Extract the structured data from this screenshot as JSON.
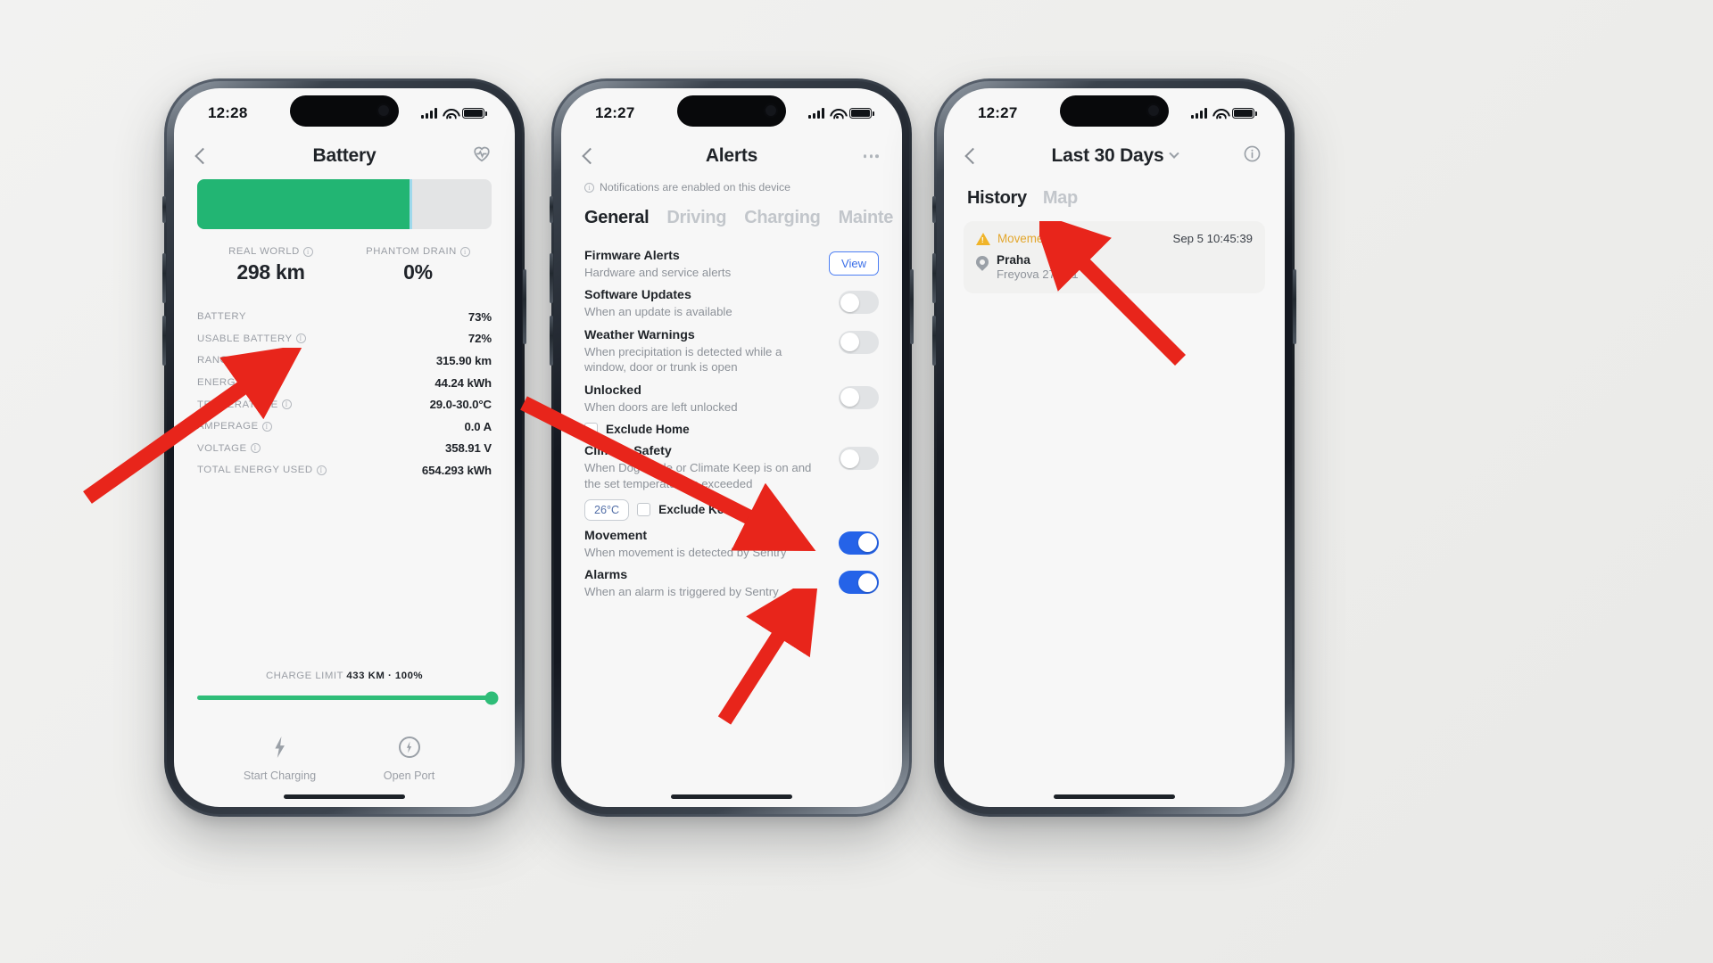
{
  "phones": [
    {
      "id": "battery",
      "status": {
        "time": "12:28",
        "signal_icon": "cellular-bars-icon",
        "wifi_icon": "wifi-icon",
        "battery_icon": "battery-icon"
      },
      "nav": {
        "back_icon": "chevron-left-icon",
        "title": "Battery",
        "right_icon": "vehicle-health-icon"
      },
      "battery_bar": {
        "charge_percent": 73,
        "usable_percent": 72,
        "fill_color": "#22b573",
        "track_color": "#e3e4e5"
      },
      "summary": [
        {
          "caption": "REAL WORLD",
          "info_icon": "info-icon",
          "value": "298 km"
        },
        {
          "caption": "PHANTOM DRAIN",
          "info_icon": "info-icon",
          "value": "0%"
        }
      ],
      "stats": [
        {
          "label": "BATTERY",
          "info": false,
          "value": "73%"
        },
        {
          "label": "USABLE BATTERY",
          "info": true,
          "value": "72%"
        },
        {
          "label": "RANGE",
          "info": true,
          "value": "315.90 km"
        },
        {
          "label": "ENERGY",
          "info": true,
          "value": "44.24 kWh"
        },
        {
          "label": "TEMPERATURE",
          "info": true,
          "value": "29.0-30.0°C"
        },
        {
          "label": "AMPERAGE",
          "info": true,
          "value": "0.0 A"
        },
        {
          "label": "VOLTAGE",
          "info": true,
          "value": "358.91 V"
        },
        {
          "label": "TOTAL ENERGY USED",
          "info": true,
          "value": "654.293 kWh"
        }
      ],
      "charge_limit": {
        "caption": "CHARGE LIMIT",
        "value": "433 KM · 100%",
        "percent": 100,
        "slider_color": "#2fbd78"
      },
      "actions": [
        {
          "icon": "bolt-icon",
          "label": "Start Charging"
        },
        {
          "icon": "charge-port-icon",
          "label": "Open Port"
        }
      ]
    },
    {
      "id": "alerts",
      "status": {
        "time": "12:27"
      },
      "nav": {
        "back_icon": "chevron-left-icon",
        "title": "Alerts",
        "right_icon": "more-options-icon"
      },
      "notice": {
        "icon": "info-icon",
        "text": "Notifications are enabled on this device"
      },
      "tabs": [
        {
          "label": "General",
          "active": true
        },
        {
          "label": "Driving",
          "active": false
        },
        {
          "label": "Charging",
          "active": false
        },
        {
          "label": "Mainte",
          "active": false
        }
      ],
      "items": [
        {
          "title": "Firmware Alerts",
          "sub": "Hardware and service alerts",
          "control": "button",
          "button_label": "View"
        },
        {
          "title": "Software Updates",
          "sub": "When an update is available",
          "control": "toggle",
          "on": false
        },
        {
          "title": "Weather Warnings",
          "sub": "When precipitation is detected while a window, door or trunk is open",
          "control": "toggle",
          "on": false
        },
        {
          "title": "Unlocked",
          "sub": "When doors are left unlocked",
          "control": "toggle",
          "on": false,
          "checkbox": {
            "label": "Exclude Home",
            "checked": false
          }
        },
        {
          "title": "Climate Safety",
          "sub": "When Dog Mode or Climate Keep is on and the set temperature is exceeded",
          "control": "toggle",
          "on": false,
          "chip": "26°C",
          "checkbox": {
            "label": "Exclude Keep",
            "checked": false
          }
        },
        {
          "title": "Movement",
          "sub": "When movement is detected by Sentry",
          "control": "toggle",
          "on": true
        },
        {
          "title": "Alarms",
          "sub": "When an alarm is triggered by Sentry",
          "control": "toggle",
          "on": true
        }
      ],
      "toggle_on_color": "#2563e8"
    },
    {
      "id": "history",
      "status": {
        "time": "12:27"
      },
      "nav": {
        "back_icon": "chevron-left-icon",
        "title": "Last 30 Days",
        "dropdown_icon": "chevron-down-icon",
        "right_icon": "info-circle-icon"
      },
      "segments": [
        {
          "label": "History",
          "active": true
        },
        {
          "label": "Map",
          "active": false
        }
      ],
      "events": [
        {
          "kind": "Movement",
          "kind_icon": "warning-triangle-icon",
          "kind_color": "#e3a62c",
          "timestamp": "Sep 5 10:45:39",
          "location_icon": "map-pin-icon",
          "city": "Praha",
          "street": "Freyova 276/21"
        }
      ]
    }
  ],
  "annotations": {
    "arrow_color": "#e8251b",
    "arrows": [
      {
        "name": "arrow-to-temperature-row"
      },
      {
        "name": "arrow-to-movement-toggle"
      },
      {
        "name": "arrow-to-alarms-toggle"
      },
      {
        "name": "arrow-to-movement-event"
      }
    ]
  }
}
